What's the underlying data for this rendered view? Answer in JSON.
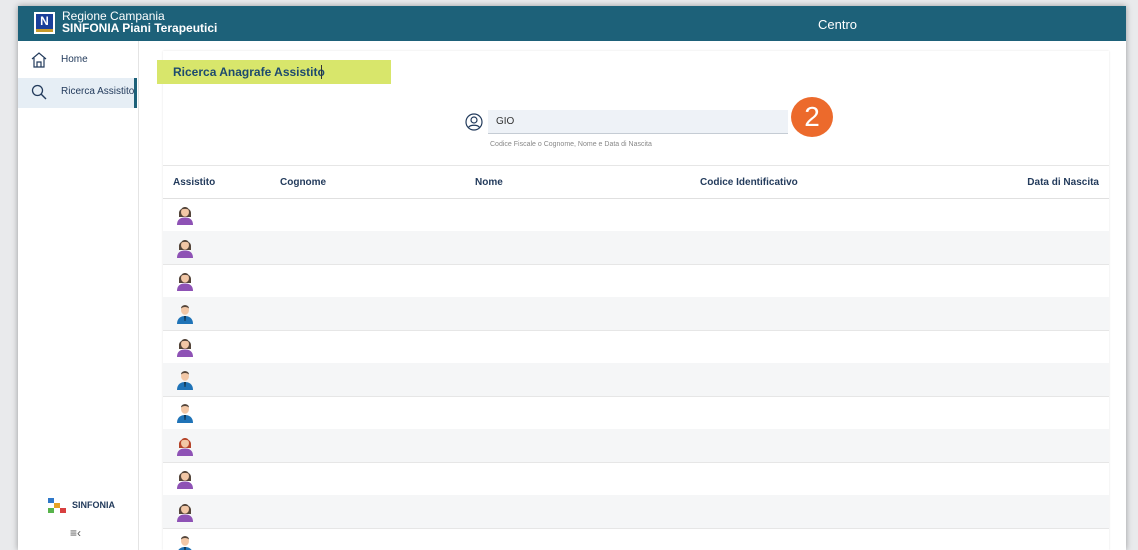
{
  "header": {
    "region": "Regione Campania",
    "app": "SINFONIA Piani Terapeutici",
    "center": "Centro"
  },
  "sidebar": {
    "items": [
      {
        "label": "Home",
        "icon": "home-icon"
      },
      {
        "label": "Ricerca Assistito",
        "icon": "search-icon"
      }
    ],
    "logo_text": "SINFONIA"
  },
  "main": {
    "title": "Ricerca Anagrafe Assistito",
    "search": {
      "value": "GIO",
      "hint": "Codice Fiscale o Cognome, Nome e Data di Nascita"
    },
    "step_badge": "2",
    "table": {
      "headers": [
        "Assistito",
        "Cognome",
        "Nome",
        "Codice Identificativo",
        "Data di Nascita"
      ],
      "rows": [
        {
          "avatar": "female"
        },
        {
          "avatar": "female"
        },
        {
          "avatar": "female"
        },
        {
          "avatar": "male"
        },
        {
          "avatar": "female"
        },
        {
          "avatar": "male"
        },
        {
          "avatar": "male"
        },
        {
          "avatar": "female-red"
        },
        {
          "avatar": "female"
        },
        {
          "avatar": "female"
        },
        {
          "avatar": "male"
        }
      ]
    }
  },
  "colors": {
    "header_bg": "#1d6179",
    "title_highlight": "#d8e66b",
    "badge": "#ec6a2c",
    "female_shirt": "#8e52b5",
    "male_shirt": "#1f73b7",
    "hair_dark": "#54453a",
    "hair_red": "#b5442a"
  }
}
